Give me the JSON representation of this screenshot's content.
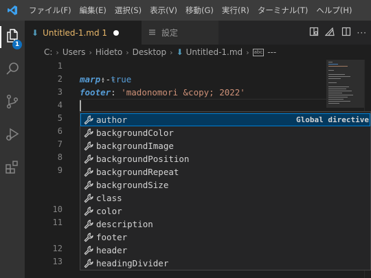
{
  "menu": [
    "ファイル(F)",
    "編集(E)",
    "選択(S)",
    "表示(V)",
    "移動(G)",
    "実行(R)",
    "ターミナル(T)",
    "ヘルプ(H)"
  ],
  "activity": {
    "explorer_badge": "1",
    "icons": [
      "files-icon",
      "search-icon",
      "source-control-icon",
      "run-debug-icon",
      "extensions-icon"
    ]
  },
  "tabs": {
    "active": "Untitled-1.md 1",
    "inactive": "設定"
  },
  "breadcrumb": {
    "drive": "C:",
    "users": "Users",
    "user": "Hideto",
    "desktop": "Desktop",
    "file": "Untitled-1.md",
    "symbol": "---"
  },
  "editor": {
    "line_numbers": [
      "1",
      "2",
      "3",
      "4",
      "5",
      "6",
      "7",
      "8",
      "9",
      "10",
      "11",
      "12",
      "13"
    ],
    "lines": {
      "l1": "---",
      "l2_key": "marp",
      "l2_colon": ": ",
      "l2_val": "true",
      "l3_key": "footer",
      "l3_colon": ": ",
      "l3_val": "'madonomori &copy; 2022'"
    }
  },
  "suggest": {
    "detail": "Global directive",
    "items": [
      "author",
      "backgroundColor",
      "backgroundImage",
      "backgroundPosition",
      "backgroundRepeat",
      "backgroundSize",
      "class",
      "color",
      "description",
      "footer",
      "header",
      "headingDivider"
    ],
    "selected_index": 0
  },
  "colors": {
    "accent": "#007fd4",
    "selection": "#04395e",
    "modified_tab": "#e9b86a"
  }
}
